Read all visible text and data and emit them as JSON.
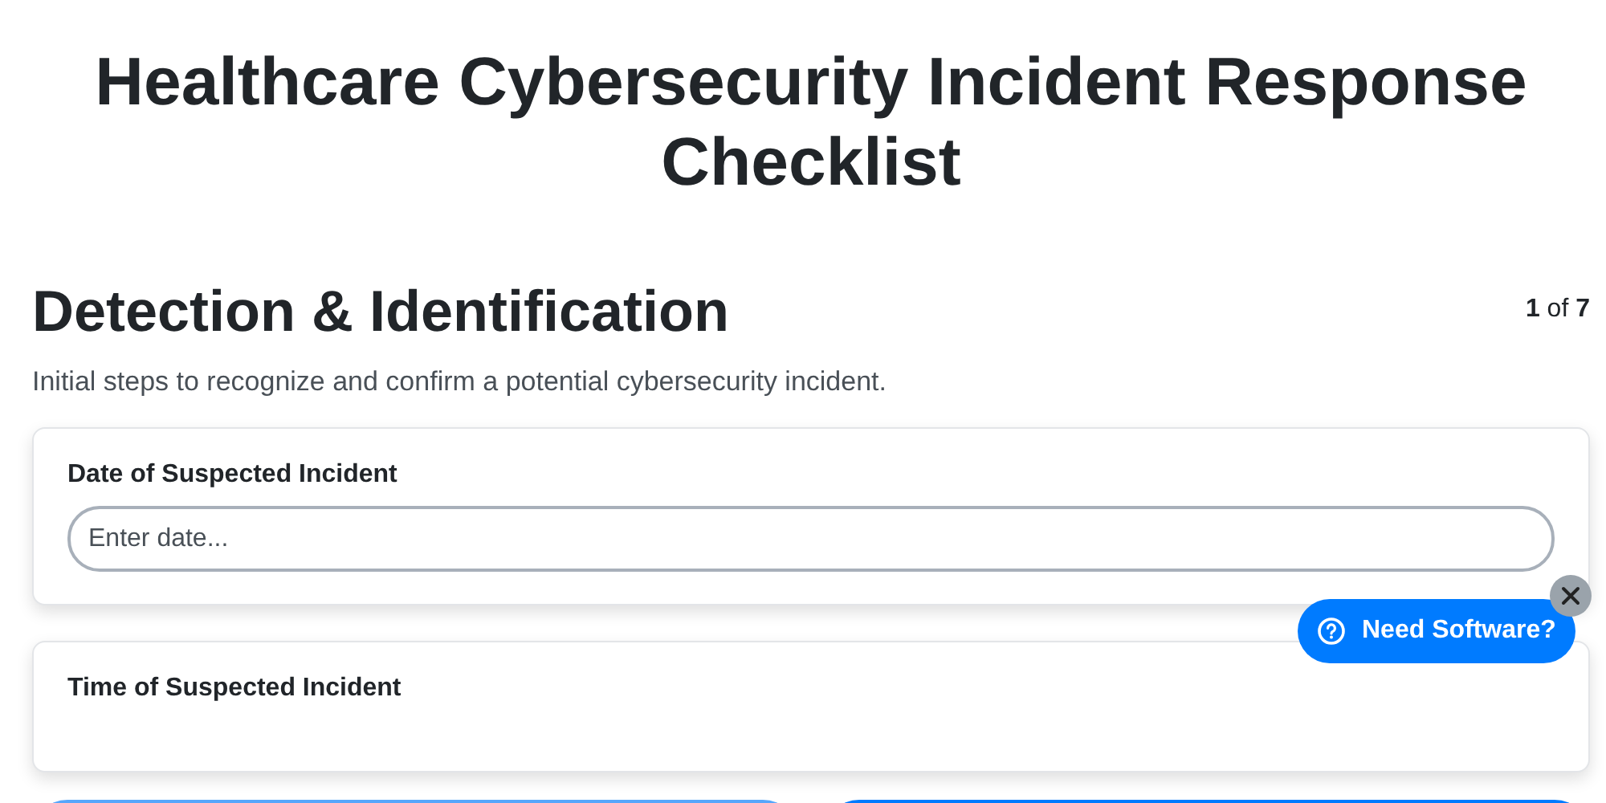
{
  "title": "Healthcare Cybersecurity Incident Response Checklist",
  "section": {
    "heading": "Detection & Identification",
    "progress": "**1** of **7**",
    "description": "Initial steps to recognize and confirm a potential cybersecurity incident."
  },
  "questions": [
    {
      "label": "Date of Suspected Incident",
      "placeholder": "Enter date..."
    },
    {
      "label": "Time of Suspected Incident"
    }
  ],
  "nav_buttons": [
    {
      "disabled": true
    },
    {
      "disabled": false
    }
  ],
  "help_widget": {
    "label": "Need Software?"
  }
}
